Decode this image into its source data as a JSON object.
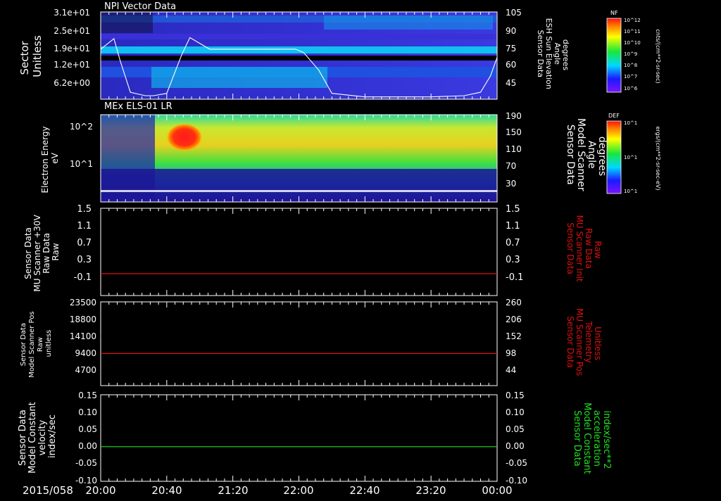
{
  "colors": {
    "background": "#000000",
    "foreground": "#ffffff",
    "red_line": "#e01010",
    "green_line": "#20e020"
  },
  "chart_data": [
    {
      "type": "heatmap",
      "title": "NPI Vector Data",
      "ylabel": [
        "Sector",
        "Unitless"
      ],
      "yticks": [
        "3.1e+01",
        "2.5e+01",
        "1.9e+01",
        "1.2e+01",
        "6.2e+00"
      ],
      "ylabel_right": [
        "Sensor Data",
        "ESH Sun Elevation",
        "Angle",
        "degrees"
      ],
      "yticks_right": [
        "105",
        "90",
        "75",
        "60",
        "45"
      ],
      "yrange_right": [
        30,
        105
      ],
      "colorbar": {
        "label": "NF",
        "unit": "cnts/(cm**2-sr-sec)",
        "ticks": [
          "10^12",
          "10^11",
          "10^10",
          "10^9",
          "10^8",
          "10^7",
          "10^6"
        ]
      },
      "overlay_line": {
        "name": "ESH Sun Elevation Angle",
        "x": [
          "20:00",
          "20:08",
          "20:12",
          "20:18",
          "20:27",
          "20:32",
          "20:40",
          "20:49",
          "20:54",
          "21:06",
          "21:20",
          "21:40",
          "21:58",
          "22:03",
          "22:12",
          "22:20",
          "22:40",
          "23:00",
          "23:20",
          "23:40",
          "23:50",
          "23:56",
          "00:00"
        ],
        "y": [
          73,
          82,
          62,
          36,
          33,
          33,
          35,
          68,
          83,
          73,
          73,
          73,
          73,
          70,
          55,
          35,
          32,
          32,
          32,
          33,
          36,
          50,
          66
        ]
      }
    },
    {
      "type": "heatmap",
      "title": "MEx ELS-01 LR",
      "ylabel": [
        "Electron Energy",
        "eV"
      ],
      "yticks": [
        "10^2",
        "10^1"
      ],
      "ylabel_right": [
        "Sensor Data",
        "Model Scanner",
        "Angle",
        "degrees"
      ],
      "yticks_right": [
        "190",
        "150",
        "110",
        "70",
        "30"
      ],
      "colorbar": {
        "label": "DEF",
        "unit": "ergs/(cm**2-sr-sec-eV)",
        "ticks": [
          "10^1",
          "10^1",
          "10^1"
        ]
      }
    },
    {
      "type": "line",
      "ylabel": [
        "Sensor Data",
        "MU Scanner +30V",
        "Raw Data",
        "Raw"
      ],
      "yticks": [
        "1.5",
        "1.1",
        "0.7",
        "0.3",
        "-0.1"
      ],
      "ylim": [
        -0.5,
        1.5
      ],
      "ylabel_right": [
        "Sensor Data",
        "MU Scanner Init",
        "Raw Data",
        "Raw"
      ],
      "yticks_right": [
        "1.5",
        "1.1",
        "0.7",
        "0.3",
        "-0.1"
      ],
      "series": [
        {
          "x": [
            "20:00",
            "00:00"
          ],
          "y": [
            0,
            0
          ]
        }
      ]
    },
    {
      "type": "line",
      "ylabel": [
        "Sensor Data",
        "Model Scanner Pos",
        "Raw",
        "unitless"
      ],
      "yticks": [
        "23500",
        "18800",
        "14100",
        "9400",
        "4700"
      ],
      "ylim": [
        0,
        23500
      ],
      "ylabel_right": [
        "Sensor Data",
        "MU Scanner Pos",
        "Telemetry",
        "Unitless"
      ],
      "yticks_right": [
        "260",
        "206",
        "152",
        "98",
        "44"
      ],
      "series": [
        {
          "x": [
            "20:00",
            "00:00"
          ],
          "y": [
            9000,
            9000
          ]
        }
      ]
    },
    {
      "type": "line",
      "ylabel": [
        "Sensor Data",
        "Model Constant",
        "velocity",
        "index/sec"
      ],
      "yticks": [
        "0.15",
        "0.10",
        "0.05",
        "0.00",
        "-0.05",
        "-0.10"
      ],
      "ylim": [
        -0.1,
        0.15
      ],
      "ylabel_right": [
        "Sensor Data",
        "Model Constant",
        "acceleration",
        "index/sec**2"
      ],
      "yticks_right": [
        "0.15",
        "0.10",
        "0.05",
        "0.00",
        "-0.05",
        "-0.10"
      ],
      "series": [
        {
          "x": [
            "20:00",
            "00:00"
          ],
          "y": [
            0,
            0
          ]
        }
      ]
    }
  ],
  "time_axis": {
    "date": "2015/058",
    "ticks": [
      "20:00",
      "20:40",
      "21:20",
      "22:00",
      "22:40",
      "23:20",
      "00:00"
    ]
  }
}
